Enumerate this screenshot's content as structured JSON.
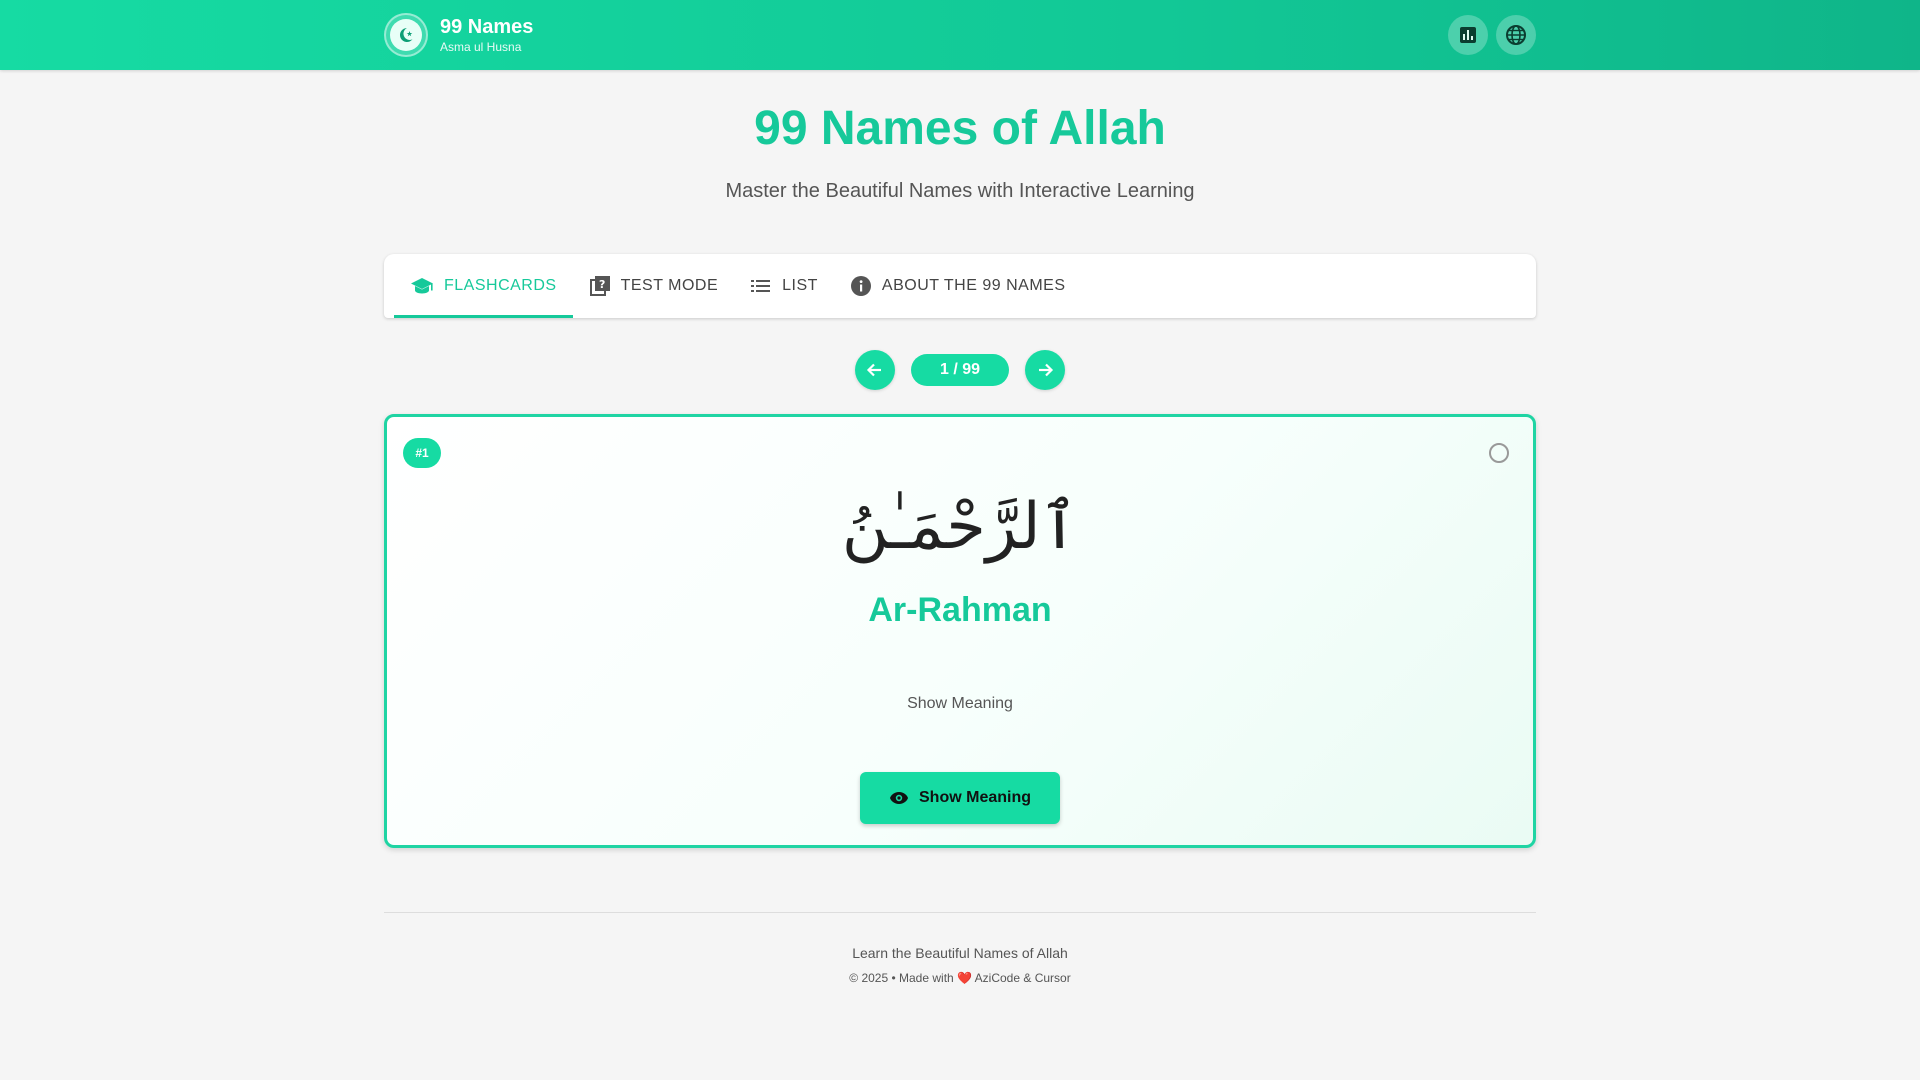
{
  "header": {
    "title": "99 Names",
    "subtitle": "Asma ul Husna",
    "actions": [
      {
        "icon": "bar-chart-icon"
      },
      {
        "icon": "globe-icon"
      }
    ]
  },
  "hero": {
    "title": "99 Names of Allah",
    "subtitle": "Master the Beautiful Names with Interactive Learning"
  },
  "tabs": [
    {
      "label": "FLASHCARDS",
      "icon": "graduation-cap-icon",
      "active": true
    },
    {
      "label": "TEST MODE",
      "icon": "quiz-icon",
      "active": false
    },
    {
      "label": "LIST",
      "icon": "list-icon",
      "active": false
    },
    {
      "label": "ABOUT THE 99 NAMES",
      "icon": "info-icon",
      "active": false
    }
  ],
  "navigation": {
    "counter": "1 / 99"
  },
  "card": {
    "badge": "#1",
    "arabic": "ٱلرَّحْمَـٰنُ",
    "transliteration": "Ar-Rahman",
    "hint": "Show Meaning",
    "button_label": "Show Meaning"
  },
  "footer": {
    "line1": "Learn the Beautiful Names of Allah",
    "line2_prefix": "© 2025 • Made with",
    "heart": "❤️",
    "line2_suffix": "AziCode & Cursor"
  },
  "colors": {
    "accent": "#16dba3",
    "accent_text": "#16c99a"
  }
}
